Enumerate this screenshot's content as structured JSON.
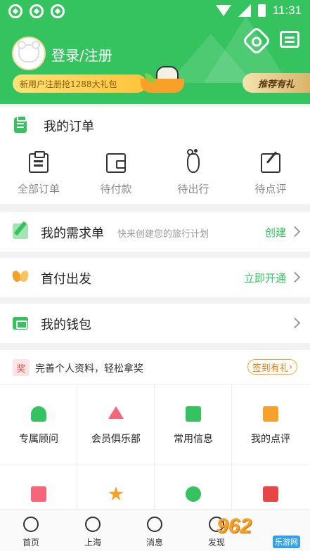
{
  "status_bar": {
    "time": "11:31"
  },
  "header": {
    "login_label": "登录/注册",
    "promo_text": "新用户注册抢1288大礼包",
    "recommend_label": "推荐有礼"
  },
  "orders": {
    "title": "我的订单",
    "items": [
      {
        "label": "全部订单",
        "icon": "clipboard-icon"
      },
      {
        "label": "待付款",
        "icon": "wallet-icon"
      },
      {
        "label": "待出行",
        "icon": "footprint-icon"
      },
      {
        "label": "待点评",
        "icon": "review-icon"
      }
    ]
  },
  "demand": {
    "title": "我的需求单",
    "subtitle": "快来创建您的旅行计划",
    "action": "创建"
  },
  "first_pay": {
    "title": "首付出发",
    "action": "立即开通"
  },
  "wallet": {
    "title": "我的钱包"
  },
  "reward": {
    "badge": "奖",
    "text": "完善个人资料，轻松拿奖",
    "button": "签到有礼"
  },
  "services": [
    {
      "label": "专属顾问",
      "icon": "advisor-icon"
    },
    {
      "label": "会员俱乐部",
      "icon": "crown-icon"
    },
    {
      "label": "常用信息",
      "icon": "info-card-icon"
    },
    {
      "label": "我的点评",
      "icon": "comment-icon"
    },
    {
      "label": "",
      "icon": "bag-icon"
    },
    {
      "label": "",
      "icon": "star-icon"
    },
    {
      "label": "",
      "icon": "clock-icon"
    },
    {
      "label": "",
      "icon": "calendar-icon"
    }
  ],
  "tabbar": [
    {
      "label": "首页",
      "icon": "home-icon"
    },
    {
      "label": "上海",
      "icon": "location-icon"
    },
    {
      "label": "消息",
      "icon": "message-icon"
    },
    {
      "label": "发现",
      "icon": "discover-icon"
    }
  ],
  "watermark": {
    "logo": "962",
    "sub": "乐游网"
  },
  "colors": {
    "brand_green": "#35c35f",
    "accent_orange": "#f7a02a"
  }
}
